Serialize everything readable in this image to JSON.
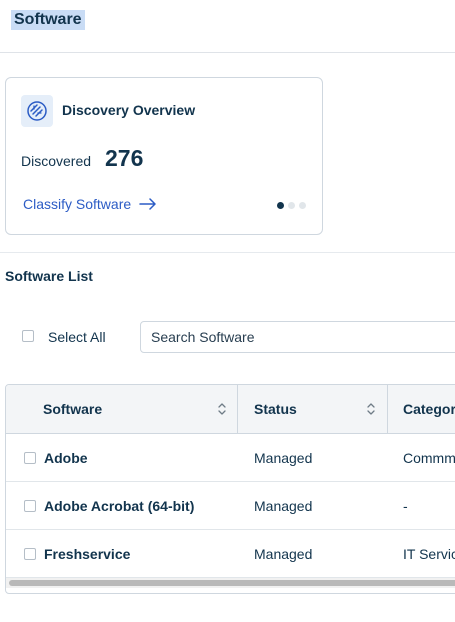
{
  "page": {
    "title": "Software"
  },
  "overview": {
    "title": "Discovery Overview",
    "icon": "discovery-icon",
    "discovered_label": "Discovered",
    "discovered_count": "276",
    "classify_link": "Classify Software",
    "carousel": {
      "total": 3,
      "active": 1
    }
  },
  "software_list": {
    "title": "Software List",
    "select_all_label": "Select All",
    "search_placeholder": "Search Software",
    "columns": [
      {
        "label": "Software",
        "sortable": true
      },
      {
        "label": "Status",
        "sortable": true
      },
      {
        "label": "Categor",
        "sortable": false
      }
    ],
    "rows": [
      {
        "name": "Adobe",
        "status": "Managed",
        "category": "Commm"
      },
      {
        "name": "Adobe Acrobat (64-bit)",
        "status": "Managed",
        "category": "-"
      },
      {
        "name": "Freshservice",
        "status": "Managed",
        "category": "IT Servic"
      }
    ]
  },
  "colors": {
    "primary_text": "#12344d",
    "link": "#2c5cc5",
    "title_highlight": "#c9dcf5",
    "border": "#cfd7df",
    "header_bg": "#f3f5f7"
  }
}
